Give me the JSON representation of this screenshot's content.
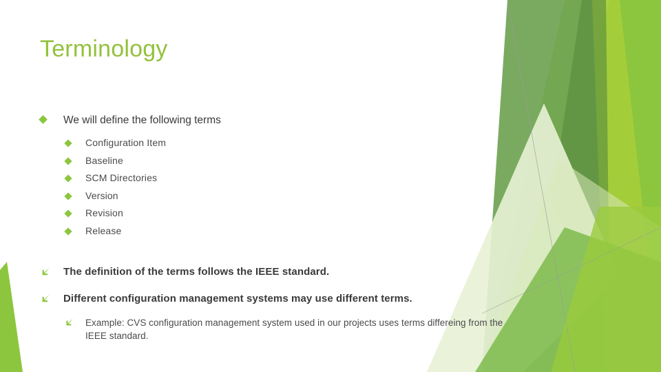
{
  "slide": {
    "title": "Terminology",
    "title_color": "#94C13D",
    "body_text_color": "#3A3A3A",
    "accent_color": "#8CC63E",
    "background_color": "#FFFFFF"
  },
  "content": {
    "intro": {
      "bullet_icon": "diamond-bullet-icon",
      "text": "We will define the following terms"
    },
    "terms": [
      {
        "bullet_icon": "diamond-bullet-icon",
        "text": "Configuration Item"
      },
      {
        "bullet_icon": "diamond-bullet-icon",
        "text": "Baseline"
      },
      {
        "bullet_icon": "diamond-bullet-icon",
        "text": "SCM Directories"
      },
      {
        "bullet_icon": "diamond-bullet-icon",
        "text": "Version"
      },
      {
        "bullet_icon": "diamond-bullet-icon",
        "text": "Revision"
      },
      {
        "bullet_icon": "diamond-bullet-icon",
        "text": "Release"
      }
    ],
    "notes": [
      {
        "bullet_icon": "arrow-down-left-icon",
        "text": "The definition of the terms follows the IEEE standard."
      },
      {
        "bullet_icon": "arrow-down-left-icon",
        "text": "Different configuration management systems may use different terms."
      }
    ],
    "example": {
      "bullet_icon": "arrow-down-left-icon",
      "text": "Example:  CVS configuration management system used in our projects uses terms differeing from the IEEE standard."
    }
  },
  "decoration": {
    "name": "green-triangles-background",
    "colors": {
      "bright_green": "#8CC63E",
      "yellow_green": "#A5CE3A",
      "medium_green": "#6FA353",
      "dark_green": "#5B8E3E",
      "pale_green": "#D9EAB9",
      "very_pale_green": "#E8F2D6",
      "light_green": "#7DBB4C",
      "line_gray": "#9A9A9A",
      "corner_wedge": "#8CC63E"
    }
  }
}
